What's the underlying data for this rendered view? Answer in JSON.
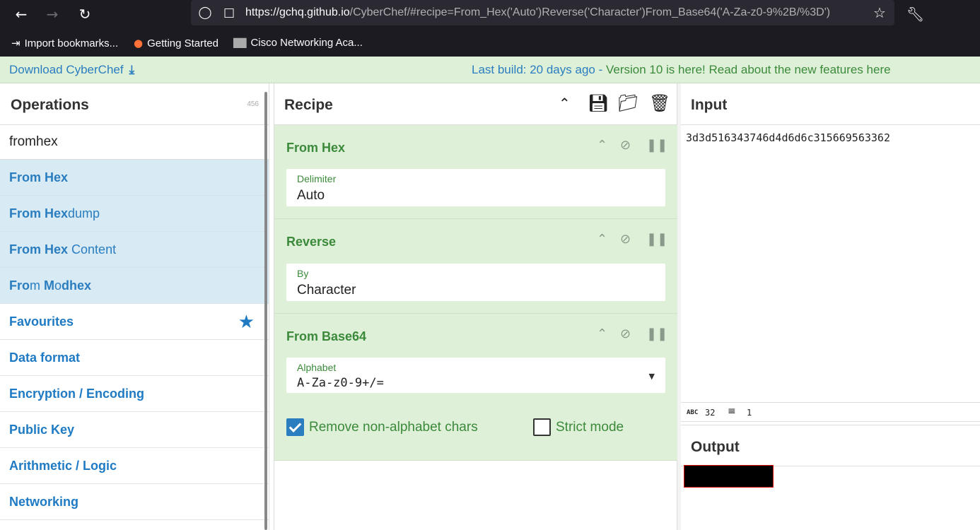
{
  "browser": {
    "back_icon": "arrow-left-icon",
    "forward_icon": "arrow-right-icon",
    "reload_icon": "reload-icon",
    "url_host": "https://gchq.github.io",
    "url_path": "/CyberChef/#recipe=From_Hex('Auto')Reverse('Character')From_Base64('A-Za-z0-9%2B/%3D')",
    "bookmarks": [
      {
        "label": "Import bookmarks..."
      },
      {
        "label": "Getting Started"
      },
      {
        "label": "Cisco Networking Aca..."
      }
    ]
  },
  "banner": {
    "download_label": "Download CyberChef",
    "build_label": "Last build: 20 days ago",
    "separator": " - ",
    "version_label": "Version 10 is here! Read about the new features here"
  },
  "operations": {
    "title": "Operations",
    "count": "456",
    "search_value": "fromhex",
    "results": [
      {
        "bold": "From Hex",
        "rest": ""
      },
      {
        "bold": "From Hex",
        "rest": "dump"
      },
      {
        "bold": "From Hex",
        "rest": " Content"
      },
      {
        "bold": "Fro",
        "rest": "m ",
        "bold2": "M",
        "rest2": "o",
        "bold3": "dhex"
      }
    ],
    "categories": [
      {
        "label": "Favourites"
      },
      {
        "label": "Data format"
      },
      {
        "label": "Encryption / Encoding"
      },
      {
        "label": "Public Key"
      },
      {
        "label": "Arithmetic / Logic"
      },
      {
        "label": "Networking"
      }
    ]
  },
  "recipe": {
    "title": "Recipe",
    "steps": [
      {
        "name": "From Hex",
        "field_label": "Delimiter",
        "field_value": "Auto"
      },
      {
        "name": "Reverse",
        "field_label": "By",
        "field_value": "Character"
      },
      {
        "name": "From Base64",
        "field_label": "Alphabet",
        "field_value": "A-Za-z0-9+/="
      }
    ],
    "checkbox_remove": {
      "label": "Remove non-alphabet chars",
      "checked": true
    },
    "checkbox_strict": {
      "label": "Strict mode",
      "checked": false
    }
  },
  "input": {
    "title": "Input",
    "value": "3d3d516343746d4d6d6c315669563362",
    "length": "32",
    "lines": "1"
  },
  "output": {
    "title": "Output"
  },
  "colors": {
    "accent": "#2a7dbf",
    "recipe_green": "#dff0d8",
    "op_highlight": "#d8eaf4"
  }
}
